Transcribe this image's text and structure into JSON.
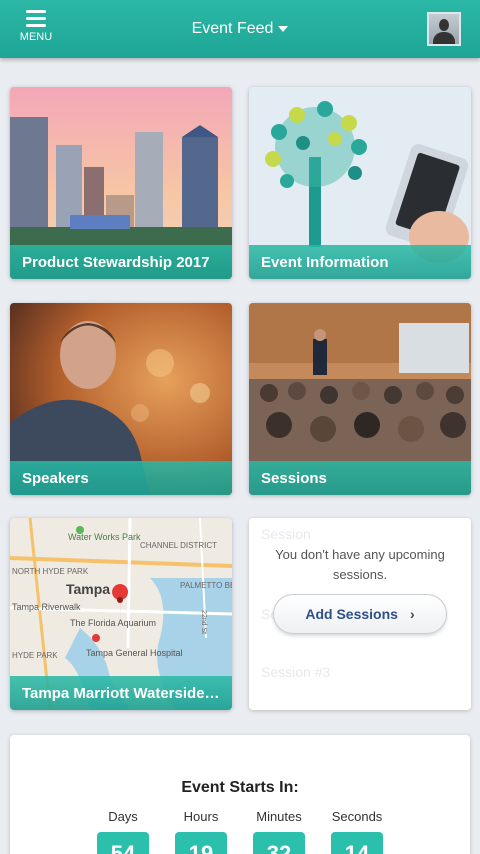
{
  "header": {
    "menu_label": "MENU",
    "title": "Event Feed"
  },
  "tiles": [
    {
      "label": "Product Stewardship 2017"
    },
    {
      "label": "Event Information"
    },
    {
      "label": "Speakers"
    },
    {
      "label": "Sessions"
    },
    {
      "label": "Tampa Marriott Waterside ..."
    }
  ],
  "map": {
    "labels": [
      "Water Works Park",
      "CHANNEL DISTRICT",
      "NORTH HYDE PARK",
      "PALMETTO BEACH",
      "Tampa",
      "Tampa Riverwalk",
      "The Florida Aquarium",
      "HYDE PARK",
      "Tampa General Hospital",
      "22nd St"
    ]
  },
  "sessions_card": {
    "empty_text": "You don't have any upcoming sessions.",
    "button_label": "Add Sessions",
    "ghost_rows": [
      "Session",
      "Session #2",
      "Session #3"
    ]
  },
  "countdown": {
    "title": "Event Starts In:",
    "units": [
      {
        "label": "Days",
        "value": "54"
      },
      {
        "label": "Hours",
        "value": "19"
      },
      {
        "label": "Minutes",
        "value": "32"
      },
      {
        "label": "Seconds",
        "value": "14"
      }
    ]
  },
  "colors": {
    "accent": "#1ea595",
    "button_text": "#2f4f8b",
    "countdown_box": "#2bc0ab"
  }
}
